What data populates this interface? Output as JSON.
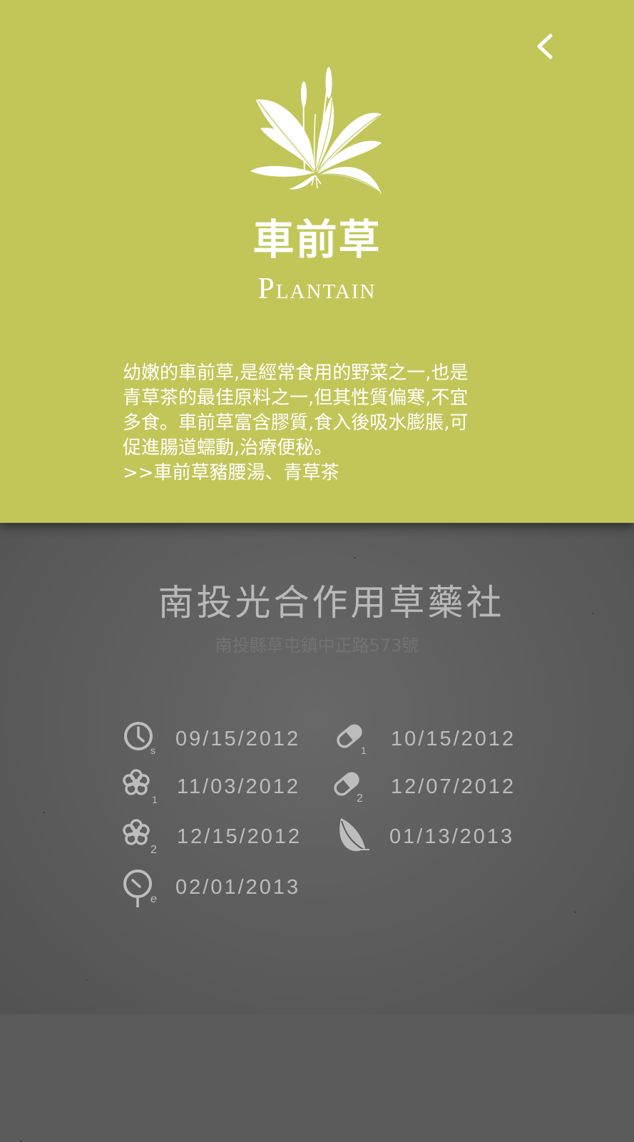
{
  "header": {
    "back_label": "<",
    "herb_name_zh": "車前草",
    "herb_name_en": "Plantain",
    "illustration_icon": "plantain-plant-illustration"
  },
  "description": {
    "lines": [
      "幼嫩的車前草,是經常食用的野菜之一,也是",
      "青草茶的最佳原料之一,但其性質偏寒,不宜",
      "多食。車前草富含膠質,食入後吸水膨脹,可",
      "促進腸道蠕動,治療便秘。"
    ],
    "recipes_link": ">>車前草豬腰湯、青草茶"
  },
  "producer": {
    "name": "南投光合作用草藥社",
    "address": "南投縣草屯鎮中正路573號"
  },
  "timeline": [
    {
      "icon": "clock-start-icon",
      "subscript": "s",
      "date": "09/15/2012"
    },
    {
      "icon": "capsule-1-icon",
      "subscript": "1",
      "date": "10/15/2012"
    },
    {
      "icon": "flower-1-icon",
      "subscript": "1",
      "date": "11/03/2012"
    },
    {
      "icon": "capsule-2-icon",
      "subscript": "2",
      "date": "12/07/2012"
    },
    {
      "icon": "flower-2-icon",
      "subscript": "2",
      "date": "12/15/2012"
    },
    {
      "icon": "leaf-icon",
      "subscript": "",
      "date": "01/13/2013"
    },
    {
      "icon": "clock-end-icon",
      "subscript": "e",
      "date": "02/01/2013"
    }
  ],
  "colors": {
    "top_panel": "#c2c659",
    "bottom_panel": "#5b5b5b",
    "text_light": "#ffffff",
    "text_grey": "#bdbdbd"
  }
}
